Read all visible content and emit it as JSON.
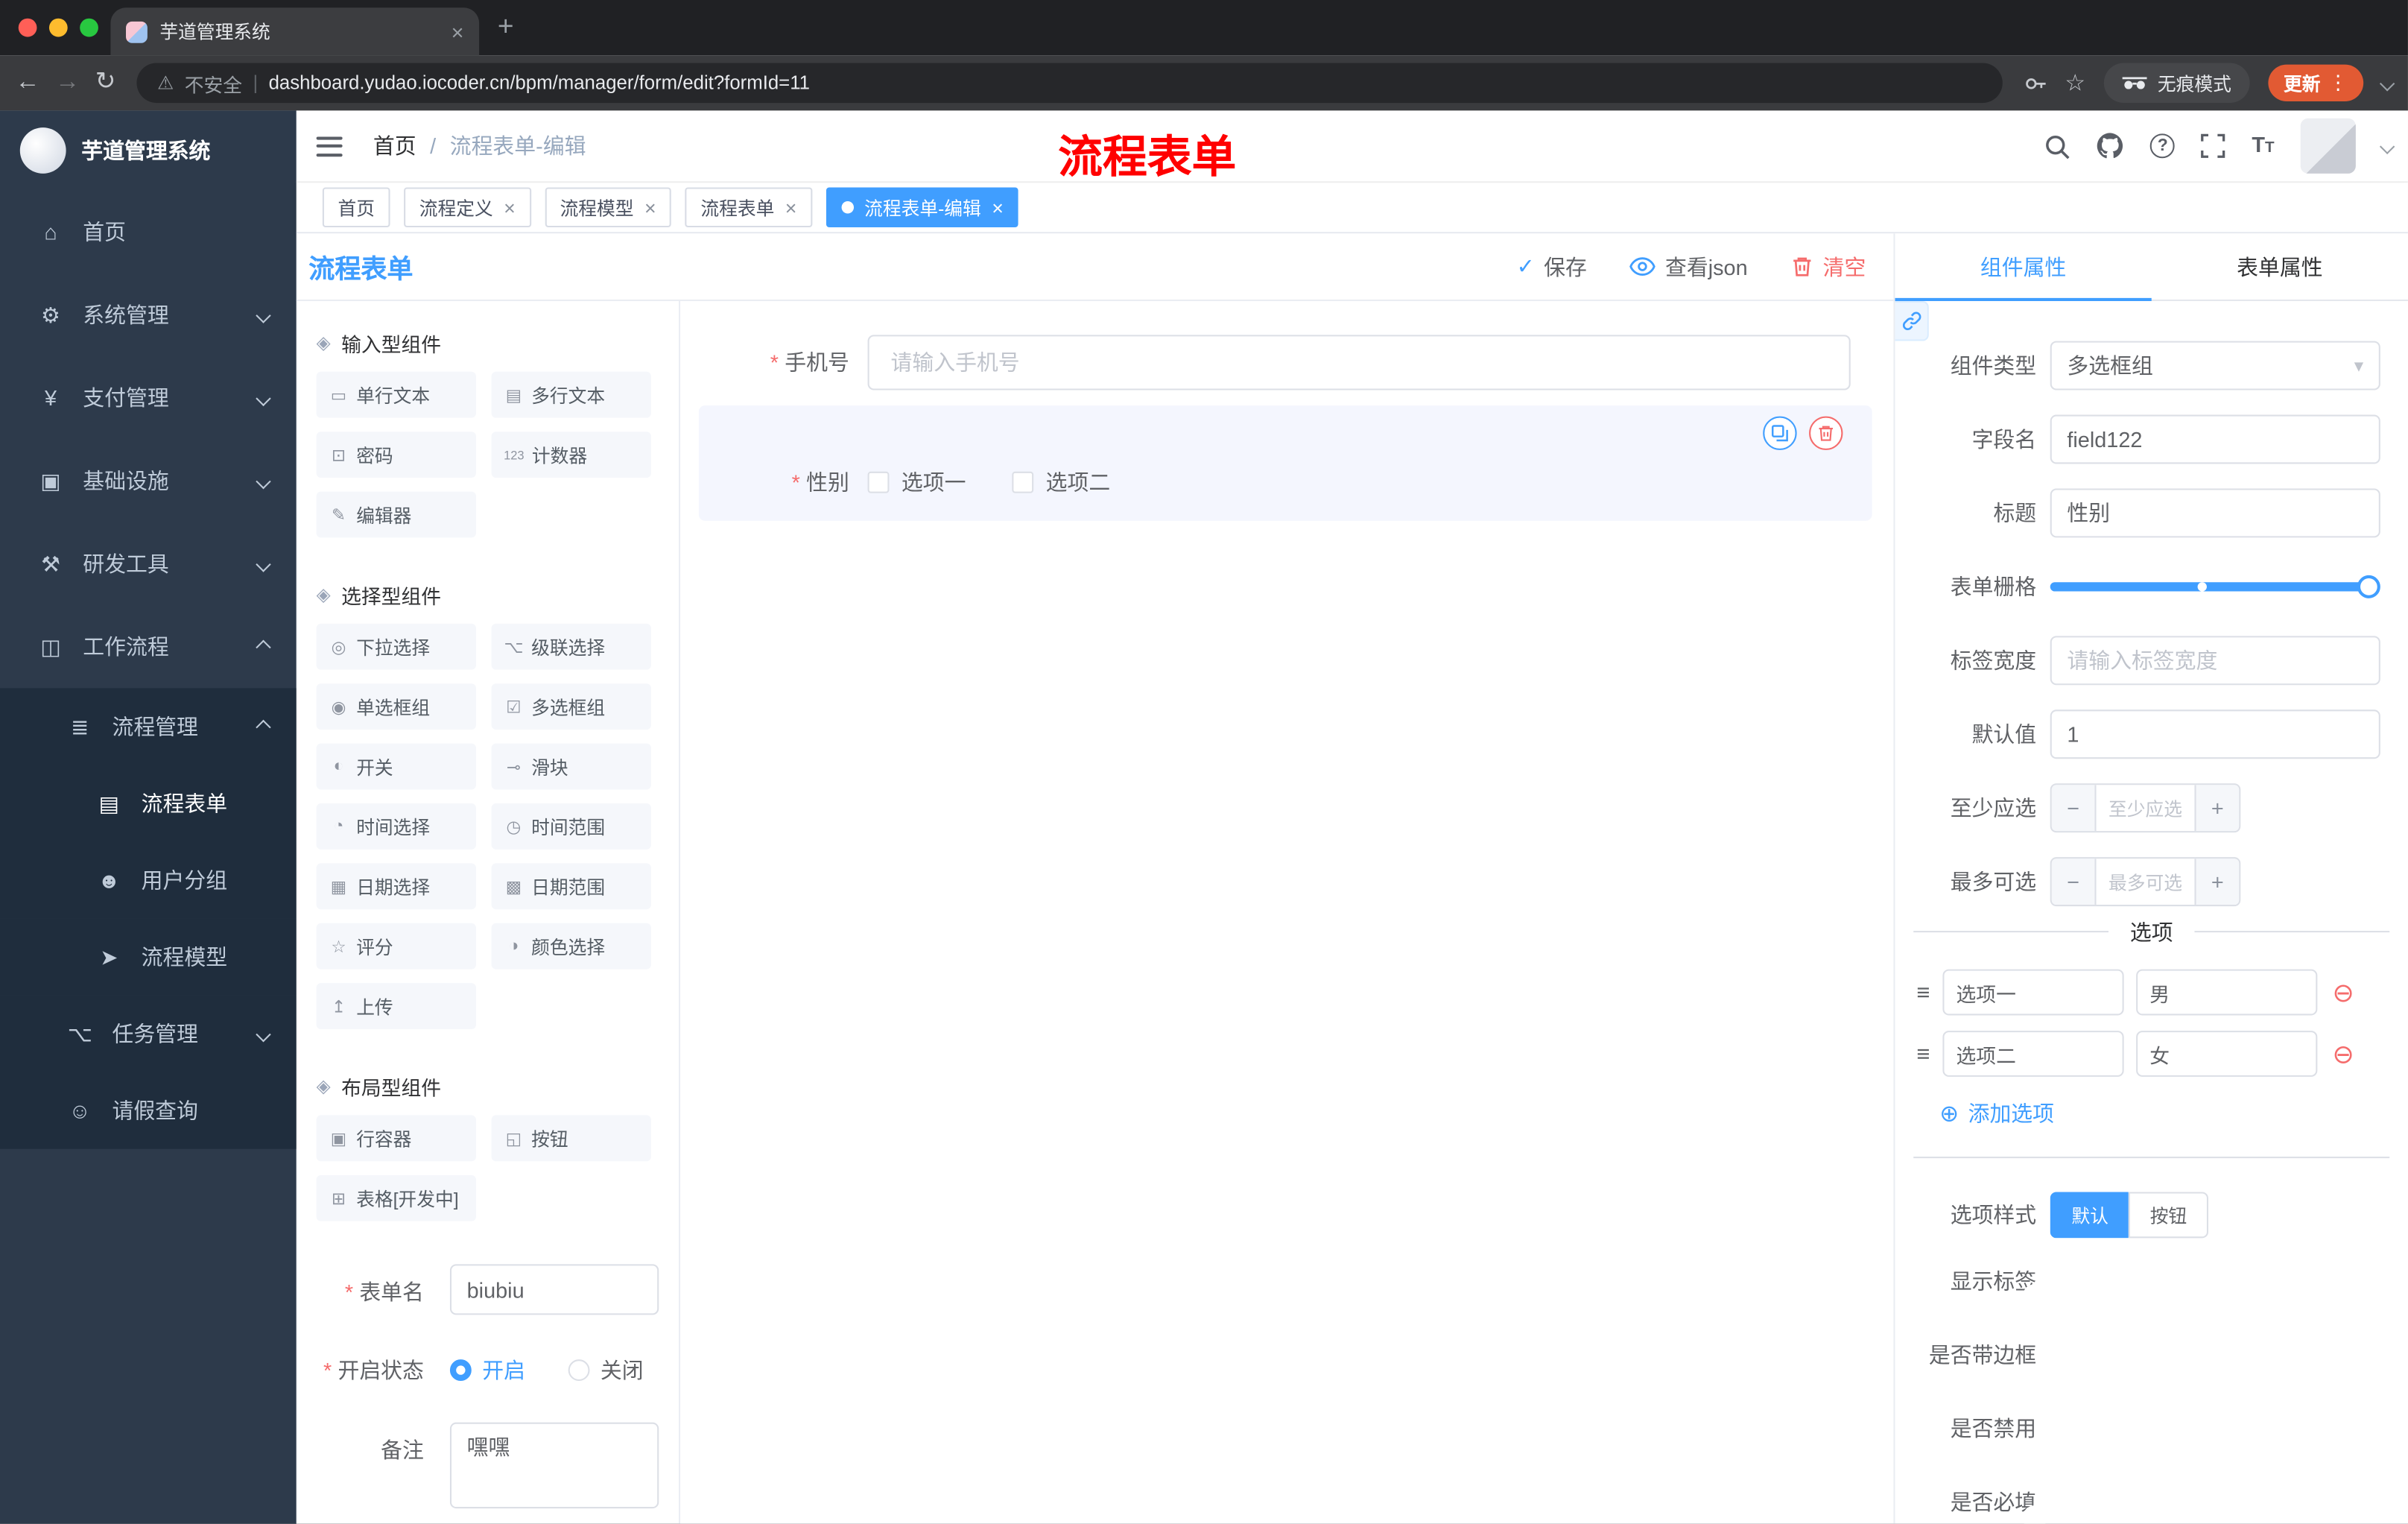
{
  "browser": {
    "tab_title": "芋道管理系统",
    "close_icon": "×",
    "new_tab_icon": "+",
    "back_icon": "←",
    "forward_icon": "→",
    "reload_icon": "↻",
    "warning_icon": "⚠",
    "security_warning": "不安全",
    "url_divider": "|",
    "url": "dashboard.yudao.iocoder.cn/bpm/manager/form/edit?formId=11",
    "star_icon": "☆",
    "incognito_label": "无痕模式",
    "update_label": "更新",
    "more_icon": "⋮"
  },
  "sidebar": {
    "logo_title": "芋道管理系统",
    "items": [
      {
        "icon": "⌂",
        "label": "首页"
      },
      {
        "icon": "⚙",
        "label": "系统管理"
      },
      {
        "icon": "¥",
        "label": "支付管理"
      },
      {
        "icon": "▣",
        "label": "基础设施"
      },
      {
        "icon": "⚒",
        "label": "研发工具"
      },
      {
        "icon": "◫",
        "label": "工作流程"
      },
      {
        "icon": "≣",
        "label": "流程管理"
      },
      {
        "icon": "▤",
        "label": "流程表单"
      },
      {
        "icon": "☻",
        "label": "用户分组"
      },
      {
        "icon": "➤",
        "label": "流程模型"
      },
      {
        "icon": "⌥",
        "label": "任务管理"
      },
      {
        "icon": "☺",
        "label": "请假查询"
      }
    ]
  },
  "header": {
    "breadcrumb_home": "首页",
    "breadcrumb_sep": "/",
    "breadcrumb_current": "流程表单-编辑",
    "annotation": "流程表单"
  },
  "tags": [
    {
      "label": "首页"
    },
    {
      "label": "流程定义"
    },
    {
      "label": "流程模型"
    },
    {
      "label": "流程表单"
    },
    {
      "label": "流程表单-编辑"
    }
  ],
  "designer": {
    "title": "流程表单",
    "actions": {
      "save_icon": "✓",
      "save": "保存",
      "view_json": "查看json",
      "clear": "清空"
    },
    "palette": {
      "group_icon": "◈",
      "groups": [
        {
          "title": "输入型组件",
          "items": [
            {
              "icon": "▭",
              "label": "单行文本"
            },
            {
              "icon": "▤",
              "label": "多行文本"
            },
            {
              "icon": "⊡",
              "label": "密码"
            },
            {
              "icon": "123",
              "label": "计数器"
            },
            {
              "icon": "✎",
              "label": "编辑器"
            }
          ]
        },
        {
          "title": "选择型组件",
          "items": [
            {
              "icon": "◎",
              "label": "下拉选择"
            },
            {
              "icon": "⌥",
              "label": "级联选择"
            },
            {
              "icon": "◉",
              "label": "单选框组"
            },
            {
              "icon": "☑",
              "label": "多选框组"
            },
            {
              "icon": "◐",
              "label": "开关"
            },
            {
              "icon": "⊸",
              "label": "滑块"
            },
            {
              "icon": "◔",
              "label": "时间选择"
            },
            {
              "icon": "◷",
              "label": "时间范围"
            },
            {
              "icon": "▦",
              "label": "日期选择"
            },
            {
              "icon": "▩",
              "label": "日期范围"
            },
            {
              "icon": "☆",
              "label": "评分"
            },
            {
              "icon": "◑",
              "label": "颜色选择"
            },
            {
              "icon": "↥",
              "label": "上传"
            }
          ]
        },
        {
          "title": "布局型组件",
          "items": [
            {
              "icon": "▣",
              "label": "行容器"
            },
            {
              "icon": "◱",
              "label": "按钮"
            },
            {
              "icon": "⊞",
              "label": "表格[开发中]"
            }
          ]
        }
      ]
    },
    "meta": {
      "name_label": "表单名",
      "name_value": "biubiu",
      "status_label": "开启状态",
      "status_on": "开启",
      "status_off": "关闭",
      "remark_label": "备注",
      "remark_value": "嘿嘿"
    },
    "canvas": {
      "phone_label": "手机号",
      "phone_placeholder": "请输入手机号",
      "gender_label": "性别",
      "gender_option1": "选项一",
      "gender_option2": "选项二"
    }
  },
  "properties": {
    "tab_component": "组件属性",
    "tab_form": "表单属性",
    "component_type_label": "组件类型",
    "component_type_value": "多选框组",
    "select_caret": "▾",
    "field_name_label": "字段名",
    "field_name_value": "field122",
    "title_label": "标题",
    "title_value": "性别",
    "grid_label": "表单栅格",
    "label_width_label": "标签宽度",
    "label_width_placeholder": "请输入标签宽度",
    "default_label": "默认值",
    "default_value": "1",
    "min_label": "至少应选",
    "min_placeholder": "至少应选",
    "max_label": "最多可选",
    "max_placeholder": "最多可选",
    "minus_icon": "−",
    "plus_icon": "+",
    "options_title": "选项",
    "drag_icon": "≡",
    "remove_icon": "⊖",
    "add_icon": "⊕",
    "options": [
      {
        "label": "选项一",
        "value": "男"
      },
      {
        "label": "选项二",
        "value": "女"
      }
    ],
    "add_option": "添加选项",
    "style_label": "选项样式",
    "style_default": "默认",
    "style_button": "按钮",
    "toggle_show_label": "显示标签",
    "toggle_border": "是否带边框",
    "toggle_disabled": "是否禁用",
    "toggle_required": "是否必填"
  },
  "colors": {
    "accent": "#409eff",
    "danger": "#f56c6c",
    "annotation": "#ff0000",
    "update_button": "#e25a33",
    "sidebar_bg": "#2d3a4b",
    "submenu_bg": "#1f2d3d"
  }
}
